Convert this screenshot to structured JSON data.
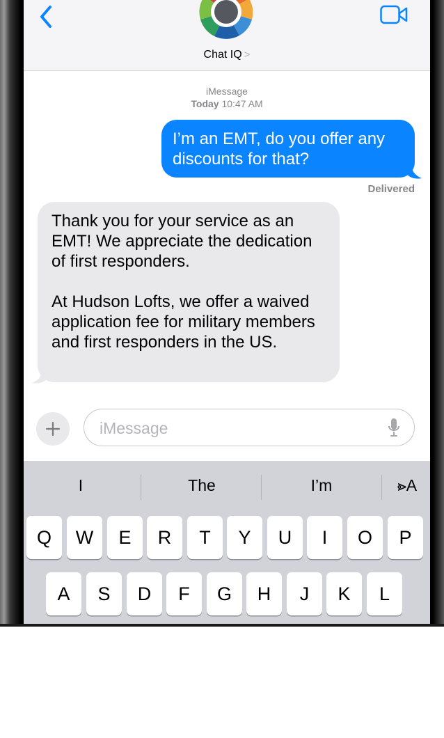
{
  "header": {
    "contact_name": "Chat IQ",
    "chevron": ">",
    "back_icon": "chevron-left-icon",
    "video_icon": "video-camera-icon",
    "accent_color": "#0b84ff"
  },
  "thread": {
    "service": "iMessage",
    "day": "Today",
    "time": "10:47 AM"
  },
  "messages": [
    {
      "direction": "outgoing",
      "text": "I’m an EMT, do you offer any discounts for that?",
      "status": "Delivered",
      "color": "#0b84ff"
    },
    {
      "direction": "incoming",
      "paragraphs": [
        "Thank you for your service as an EMT! We appreciate the dedication of first responders.",
        "At Hudson Lofts, we offer a waived application fee for military members and first responders in the US."
      ],
      "color": "#e9e9eb"
    }
  ],
  "composer": {
    "plus_label": "+",
    "placeholder": "iMessage",
    "mic_icon": "microphone-icon"
  },
  "keyboard": {
    "suggestions": [
      "I",
      "The",
      "I’m"
    ],
    "format_label": "⩺A",
    "row1": [
      "Q",
      "W",
      "E",
      "R",
      "T",
      "Y",
      "U",
      "I",
      "O",
      "P"
    ],
    "row2": [
      "A",
      "S",
      "D",
      "F",
      "G",
      "H",
      "J",
      "K",
      "L"
    ]
  }
}
